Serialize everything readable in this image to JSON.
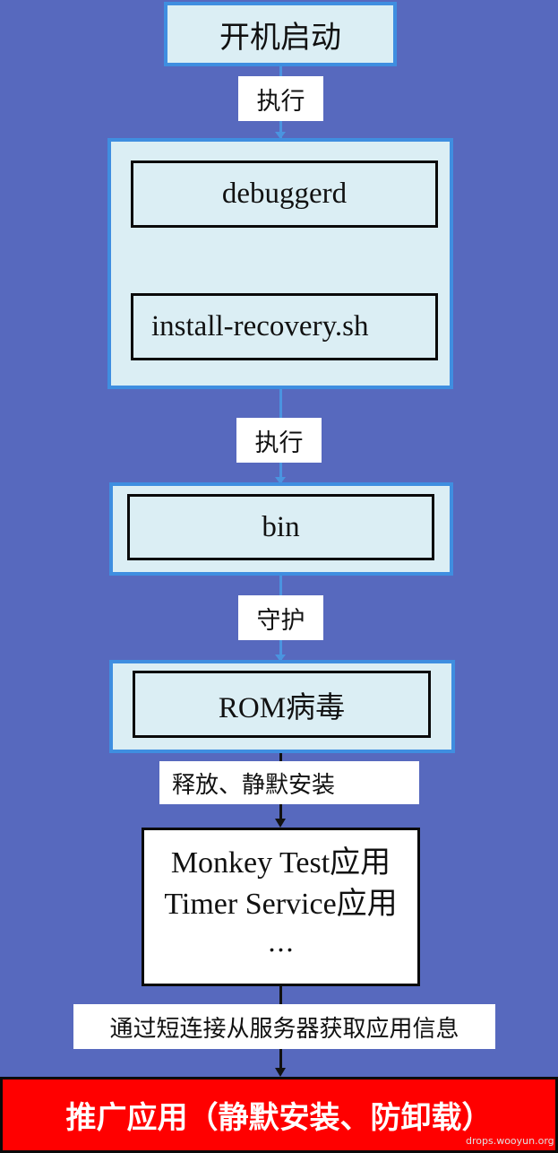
{
  "boot": "开机启动",
  "exec1": "执行",
  "debuggerd": "debuggerd",
  "install_recovery": "install-recovery.sh",
  "exec2": "执行",
  "bin": "bin",
  "guard": "守护",
  "rom_virus": "ROM病毒",
  "release_install": "释放、静默安装",
  "apps": {
    "line1": "Monkey Test应用",
    "line2": "Timer Service应用",
    "line3": "…"
  },
  "fetch_info": "通过短连接从服务器获取应用信息",
  "promote": "推广应用（静默安装、防卸载）",
  "watermark": "drops.wooyun.org",
  "colors": {
    "background": "#5769be",
    "light_box": "#dbeef4",
    "blue_border": "#3f8ee0",
    "red": "#ff0000"
  }
}
